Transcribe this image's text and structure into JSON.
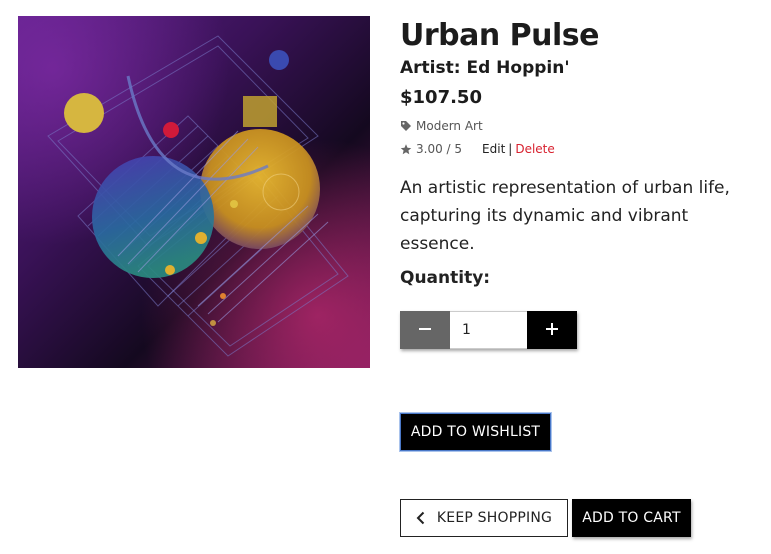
{
  "product": {
    "title": "Urban Pulse",
    "artist": "Artist: Ed Hoppin'",
    "price": "$107.50",
    "category": "Modern Art",
    "rating": "3.00 / 5",
    "edit_label": "Edit",
    "separator": "|",
    "delete_label": "Delete",
    "description": "An artistic representation of urban life, capturing its dynamic and vibrant essence."
  },
  "quantity": {
    "label": "Quantity:",
    "value": "1"
  },
  "buttons": {
    "wishlist": "ADD TO WISHLIST",
    "keep_shopping": "KEEP SHOPPING",
    "add_to_cart": "ADD TO CART"
  },
  "icons": {
    "category": "tag-icon",
    "rating": "star-icon",
    "minus": "minus-icon",
    "plus": "plus-icon",
    "back": "chevron-left-icon"
  },
  "colors": {
    "delete": "#d8212f",
    "wishlist_border": "#4a78c8",
    "primary_button": "#000000",
    "minus_button": "#666666"
  }
}
